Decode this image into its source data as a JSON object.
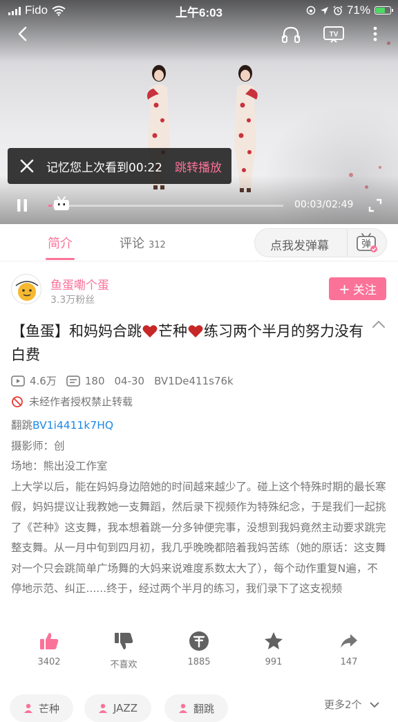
{
  "status_bar": {
    "carrier": "Fido",
    "time": "上午6:03",
    "battery_percent": "71%",
    "battery_level": 0.71
  },
  "player": {
    "resume_message": "记忆您上次看到00:22",
    "resume_action": "跳转播放",
    "time_display": "00:03/02:49",
    "progress_fraction": 0.018,
    "icons": [
      "back-icon",
      "headphones-icon",
      "tv-cast-icon",
      "more-vertical-icon",
      "close-icon",
      "pause-icon",
      "fullscreen-icon"
    ]
  },
  "tabs": {
    "intro_label": "简介",
    "comments_label": "评论",
    "comments_count": "312",
    "danmaku_placeholder": "点我发弹幕",
    "danmaku_icon_label": "弹"
  },
  "uploader": {
    "name": "鱼蛋嘞个蛋",
    "fans": "3.3万粉丝",
    "follow_label": "关注"
  },
  "video": {
    "title_part1": "【鱼蛋】和妈妈合跳",
    "title_part2": "芒种",
    "title_part3": "练习两个半月的努力没有白费",
    "views": "4.6万",
    "danmaku_count": "180",
    "date": "04-30",
    "bvid": "BV1De411s76k",
    "copyright_notice": "未经作者授权禁止转载",
    "desc_fanjump_prefix": "翻跳",
    "desc_fanjump_link": "BV1i4411k7HQ",
    "desc_photographer": "摄影师：创",
    "desc_venue": "场地：熊出没工作室",
    "desc_body": "上大学以后，能在妈妈身边陪她的时间越来越少了。碰上这个特殊时期的最长寒假，妈妈提议让我教她一支舞蹈，然后录下视频作为特殊纪念，于是我们一起挑了《芒种》这支舞，我本想着跳一分多钟便完事，没想到我妈竟然主动要求跳完整支舞。从一月中旬到四月初，我几乎晚晚都陪着我妈苦练（她的原话：这支舞对一个只会跳简单广场舞的大妈来说难度系数太大了），每个动作重复N遍，不停地示范、纠正......终于，经过两个半月的练习，我们录下了这支视频"
  },
  "actions": [
    {
      "name": "like",
      "count": "3402"
    },
    {
      "name": "dislike",
      "label": "不喜欢"
    },
    {
      "name": "coin",
      "count": "1885"
    },
    {
      "name": "favorite",
      "count": "991"
    },
    {
      "name": "share",
      "count": "147"
    }
  ],
  "tags": [
    "芒种",
    "JAZZ",
    "翻跳"
  ],
  "tags_more": "更多2个",
  "colors": {
    "accent": "#fb7299",
    "link": "#1e88e5",
    "heart": "#d32f2f"
  }
}
